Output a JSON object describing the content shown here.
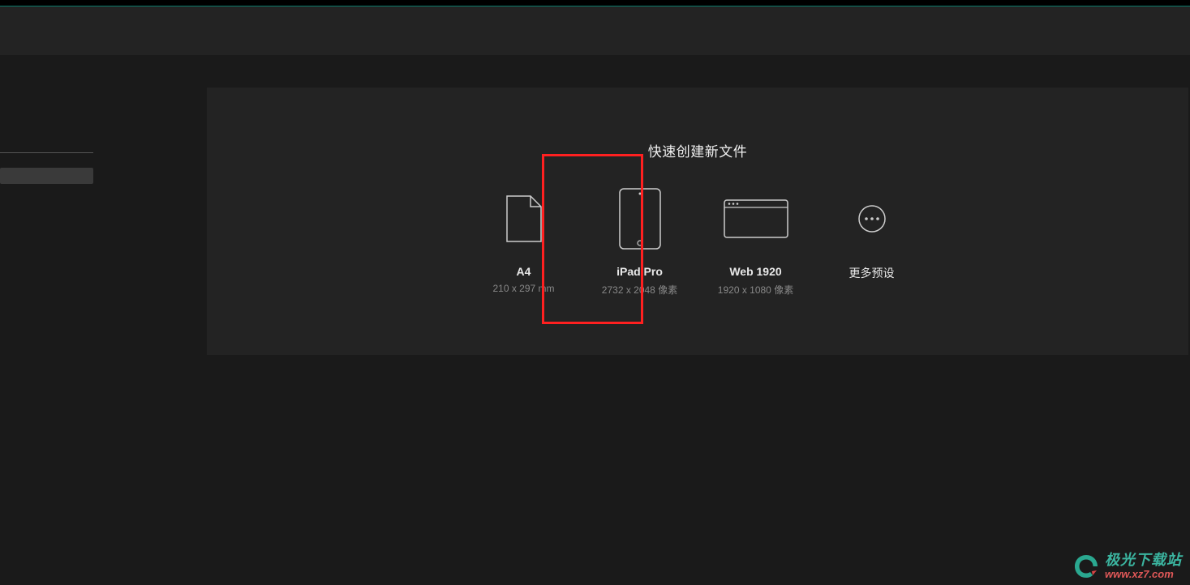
{
  "panel": {
    "title": "快速创建新文件"
  },
  "presets": [
    {
      "icon": "document",
      "title": "A4",
      "subtitle": "210 x 297 mm"
    },
    {
      "icon": "ipad",
      "title": "iPad Pro",
      "subtitle": "2732 x 2048 像素"
    },
    {
      "icon": "web",
      "title": "Web 1920",
      "subtitle": "1920 x 1080 像素"
    }
  ],
  "more": {
    "label": "更多预设"
  },
  "watermark": {
    "title": "极光下载站",
    "url": "www.xz7.com"
  }
}
